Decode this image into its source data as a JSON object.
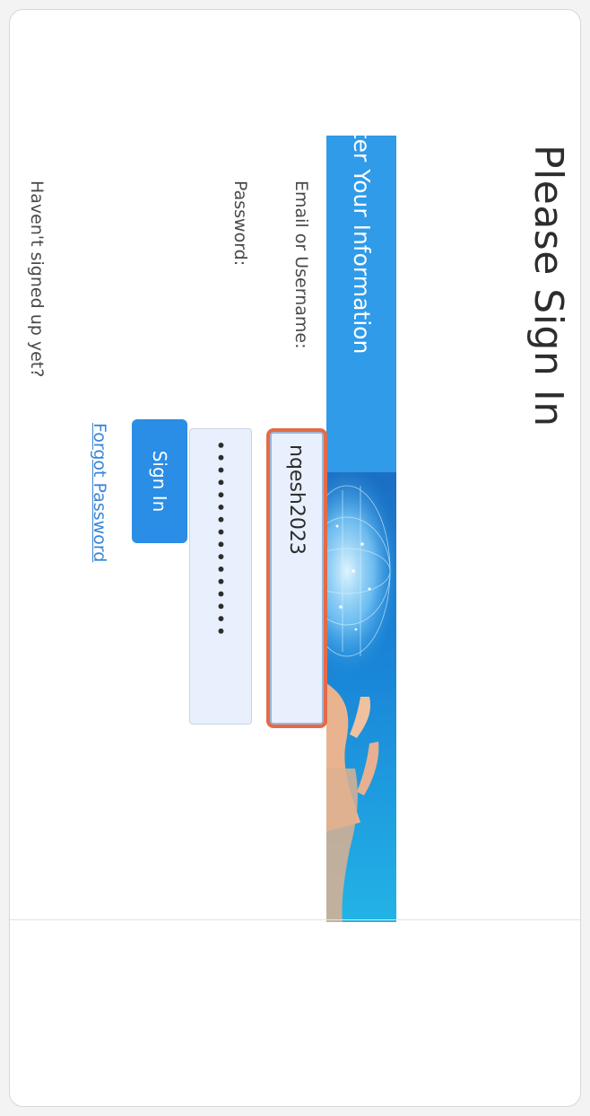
{
  "page": {
    "title": "Please Sign In"
  },
  "banner": {
    "text": "nter Your Information",
    "image": "globe-hand-photo"
  },
  "form": {
    "email_label": "Email or Username:",
    "email_value": "nqesh2023",
    "password_label": "Password:",
    "password_value": "••••••••••••••••",
    "signin_label": "Sign In",
    "forgot_label": "Forgot Password",
    "signup_prompt": "Haven't signed up yet?"
  },
  "colors": {
    "accent": "#2a8de6",
    "focus_ring": "#e36b47",
    "input_bg": "#e8f0fe"
  }
}
